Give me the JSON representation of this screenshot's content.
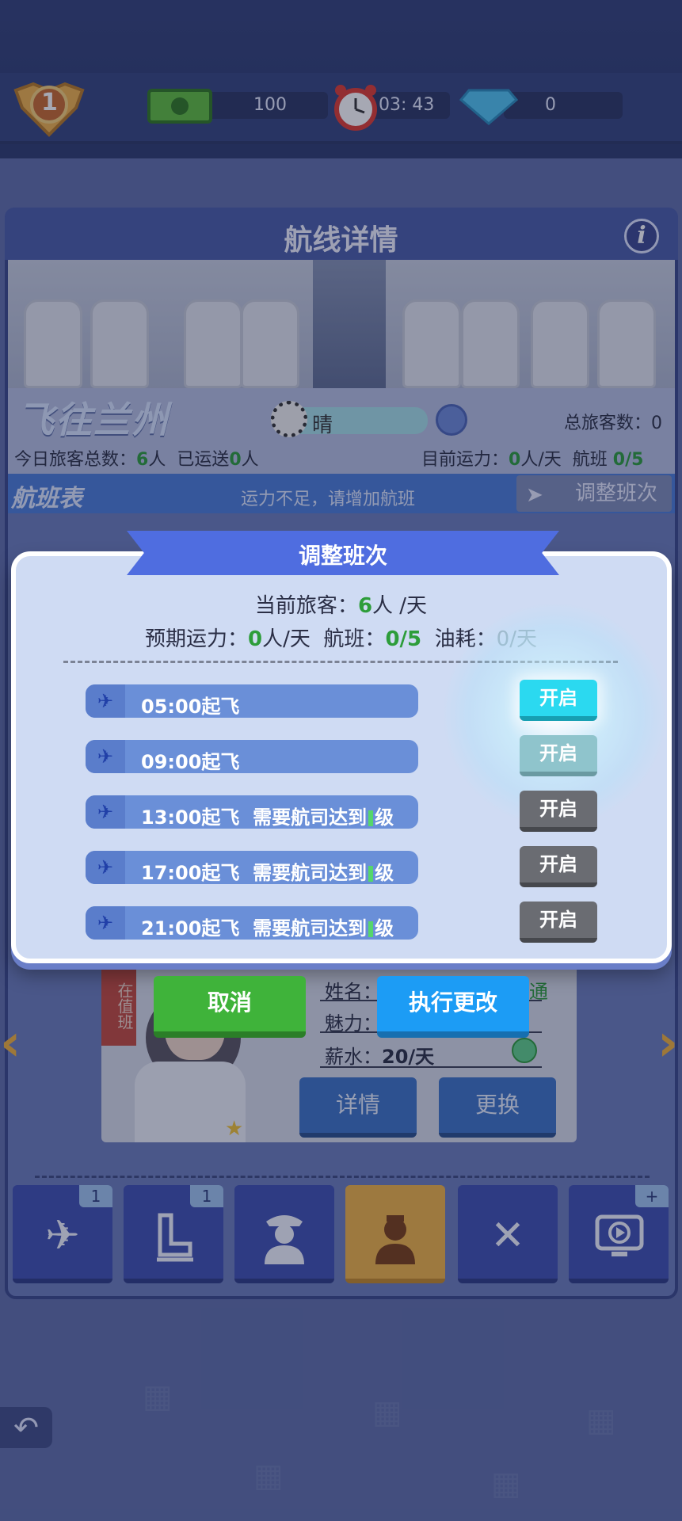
{
  "hud": {
    "rank": "1",
    "cash": "100",
    "timer": "03: 43",
    "gems": "0"
  },
  "route_panel": {
    "title": "航线详情",
    "info_icon_char": "i",
    "destination": "飞往兰州",
    "weather": "晴",
    "total_passengers_label": "总旅客数：",
    "total_passengers_value": "0",
    "today_passengers_label": "今日旅客总数：",
    "today_passengers_value": "6",
    "today_passengers_unit": "人",
    "shipped_label": "已运送",
    "shipped_value": "0",
    "shipped_unit": "人",
    "capacity_label": "目前运力：",
    "capacity_value": "0",
    "capacity_unit": "人/天",
    "flights_label": "航班",
    "flights_value": "0/5",
    "schedule_title": "航班表",
    "schedule_hint": "运力不足，请增加航班",
    "adjust_button": "调整班次"
  },
  "staff": {
    "ribbon": "在值班",
    "name_label": "姓名：",
    "name_tail": "通",
    "charm_label": "魅力：",
    "salary_label": "薪水：",
    "salary_value": "20/天",
    "details_button": "详情",
    "replace_button": "更换"
  },
  "tabs": [
    {
      "icon": "airplane-icon",
      "badge": "1"
    },
    {
      "icon": "seat-icon",
      "badge": "1"
    },
    {
      "icon": "pilot-icon",
      "badge": ""
    },
    {
      "icon": "flight-attendant-icon",
      "badge": ""
    },
    {
      "icon": "catering-icon",
      "badge": ""
    },
    {
      "icon": "entertainment-icon",
      "badge": "+"
    }
  ],
  "modal": {
    "title": "调整班次",
    "current_passengers_label": "当前旅客：",
    "current_passengers_value": "6",
    "current_passengers_unit": "人 /天",
    "expected_capacity_label": "预期运力：",
    "expected_capacity_value": "0",
    "expected_capacity_unit": "人/天",
    "flights_label": "航班：",
    "flights_value": "0/5",
    "fuel_label": "油耗：",
    "fuel_value": "0",
    "fuel_unit": "/天",
    "toggle_label": "开启",
    "flights": [
      {
        "time": "05:00起飞",
        "requirement": ""
      },
      {
        "time": "09:00起飞",
        "requirement": ""
      },
      {
        "time": "13:00起飞",
        "requirement": "需要航司达到",
        "req_tail": "级"
      },
      {
        "time": "17:00起飞",
        "requirement": "需要航司达到",
        "req_tail": "级"
      },
      {
        "time": "21:00起飞",
        "requirement": "需要航司达到",
        "req_tail": "级"
      }
    ],
    "cancel_button": "取消",
    "apply_button": "执行更改"
  },
  "colors": {
    "accent_green": "#2d9d3a",
    "toggle_active": "#2bd9f0",
    "toggle_disabled": "#6a6c72",
    "cancel_green": "#3fb33a",
    "apply_blue": "#1c9cf5"
  }
}
